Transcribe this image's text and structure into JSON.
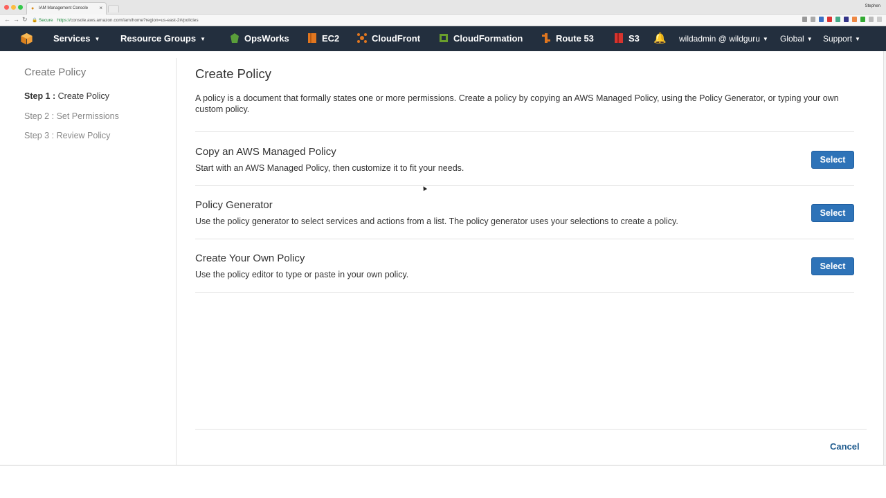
{
  "browser": {
    "tab_title": "IAM Management Console",
    "tab_close": "×",
    "profile": "Stephen",
    "secure_label": "Secure",
    "url_scheme": "https://",
    "url_rest": "console.aws.amazon.com/iam/home?region=us-east-2#/policies"
  },
  "navbar": {
    "services": "Services",
    "resource_groups": "Resource Groups",
    "shortcuts": [
      {
        "label": "OpsWorks",
        "icon": "opsworks-icon",
        "color": "#5a9e3a"
      },
      {
        "label": "EC2",
        "icon": "ec2-icon",
        "color": "#e0761f"
      },
      {
        "label": "CloudFront",
        "icon": "cloudfront-icon",
        "color": "#e0761f"
      },
      {
        "label": "CloudFormation",
        "icon": "cloudformation-icon",
        "color": "#6a9e2c"
      },
      {
        "label": "Route 53",
        "icon": "route53-icon",
        "color": "#e0761f"
      },
      {
        "label": "S3",
        "icon": "s3-icon",
        "color": "#d6342e"
      }
    ],
    "account": "wildadmin @ wildguru",
    "region": "Global",
    "support": "Support"
  },
  "sidebar": {
    "title": "Create Policy",
    "steps": [
      {
        "num": "Step 1 :",
        "label": " Create Policy"
      },
      {
        "num": "Step 2 :",
        "label": " Set Permissions"
      },
      {
        "num": "Step 3 :",
        "label": " Review Policy"
      }
    ]
  },
  "main": {
    "title": "Create Policy",
    "intro": "A policy is a document that formally states one or more permissions. Create a policy by copying an AWS Managed Policy, using the Policy Generator, or typing your own custom policy.",
    "options": [
      {
        "title": "Copy an AWS Managed Policy",
        "desc": "Start with an AWS Managed Policy, then customize it to fit your needs.",
        "button": "Select"
      },
      {
        "title": "Policy Generator",
        "desc": "Use the policy generator to select services and actions from a list. The policy generator uses your selections to create a policy.",
        "button": "Select"
      },
      {
        "title": "Create Your Own Policy",
        "desc": "Use the policy editor to type or paste in your own policy.",
        "button": "Select"
      }
    ],
    "cancel": "Cancel"
  },
  "colors": {
    "navbar_bg": "#232f3e",
    "button_blue": "#2e73b8",
    "link_blue": "#1f5b8e"
  }
}
